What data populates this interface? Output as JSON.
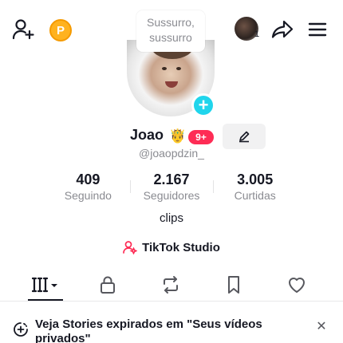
{
  "topbar": {
    "coin_letter": "P",
    "story_count": "1"
  },
  "speech_bubble": {
    "line1": "Sussurro,",
    "line2": "sussurro"
  },
  "profile": {
    "name": "Joao",
    "crown_emoji": "🤴",
    "level_badge": "9+",
    "username": "@joaopdzin_",
    "bio": "clips"
  },
  "stats": [
    {
      "value": "409",
      "label": "Seguindo"
    },
    {
      "value": "2.167",
      "label": "Seguidores"
    },
    {
      "value": "3.005",
      "label": "Curtidas"
    }
  ],
  "studio": {
    "label": "TikTok Studio"
  },
  "tabs": [
    {
      "icon": "videos-grid-icon",
      "active": true
    },
    {
      "icon": "lock-icon",
      "active": false
    },
    {
      "icon": "repost-icon",
      "active": false
    },
    {
      "icon": "bookmark-icon",
      "active": false
    },
    {
      "icon": "heart-icon",
      "active": false
    }
  ],
  "banner": {
    "text": "Veja Stories expirados em \"Seus vídeos privados\"",
    "close_symbol": "✕"
  },
  "colors": {
    "accent_red": "#fe2c55",
    "accent_cyan": "#20d5ec",
    "coin_gold": "#ffb21f",
    "text_primary": "#161823",
    "text_secondary": "#8a8b91"
  }
}
